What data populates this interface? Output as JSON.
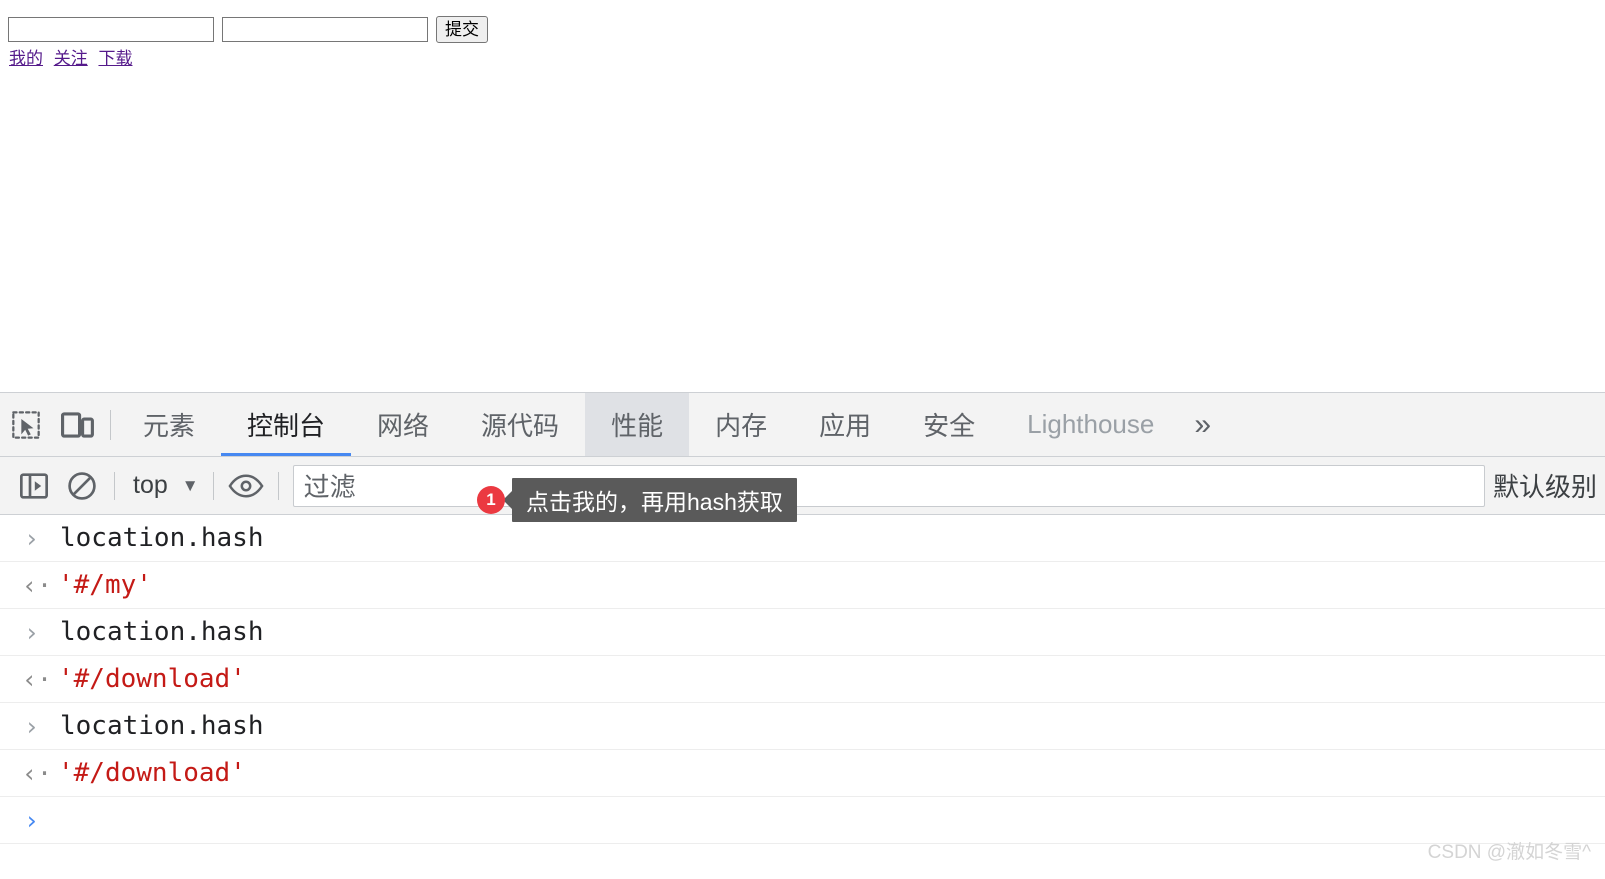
{
  "page": {
    "inputs": [
      {
        "name": "first-text-input",
        "value": "",
        "placeholder": ""
      },
      {
        "name": "second-text-input",
        "value": "",
        "placeholder": ""
      }
    ],
    "submit_label": "提交",
    "links": [
      {
        "label": "我的"
      },
      {
        "label": "关注"
      },
      {
        "label": "下载"
      }
    ],
    "link_color": "#551a8b"
  },
  "devtools": {
    "toolbar_icons": [
      {
        "name": "inspect-element-icon"
      },
      {
        "name": "device-toolbar-icon"
      }
    ],
    "tabs": [
      {
        "label": "元素",
        "state": "normal"
      },
      {
        "label": "控制台",
        "state": "active"
      },
      {
        "label": "网络",
        "state": "normal"
      },
      {
        "label": "源代码",
        "state": "normal"
      },
      {
        "label": "性能",
        "state": "hovered"
      },
      {
        "label": "内存",
        "state": "normal"
      },
      {
        "label": "应用",
        "state": "normal"
      },
      {
        "label": "安全",
        "state": "normal"
      },
      {
        "label": "Lighthouse",
        "state": "muted"
      }
    ],
    "overflow_label": "»",
    "accent_color": "#4688f1",
    "console_toolbar": {
      "sidebar_toggle": "show-console-sidebar-icon",
      "clear_console": "clear-console-icon",
      "context_value": "top",
      "context_caret": "▼",
      "live_expression": "eye-icon",
      "filter_placeholder": "过滤",
      "badge_count": "1",
      "level_label": "默认级别"
    },
    "tooltip": {
      "text": "点击我的，再用hash获取",
      "background": "#5a5a5a"
    },
    "console_entries": [
      {
        "kind": "input",
        "marker": "›",
        "text": "location.hash"
      },
      {
        "kind": "result",
        "marker": "‹·",
        "text": "'#/my'"
      },
      {
        "kind": "input",
        "marker": "›",
        "text": "location.hash"
      },
      {
        "kind": "result",
        "marker": "‹·",
        "text": "'#/download'"
      },
      {
        "kind": "input",
        "marker": "›",
        "text": "location.hash"
      },
      {
        "kind": "result",
        "marker": "‹·",
        "text": "'#/download'"
      },
      {
        "kind": "prompt",
        "marker": "›",
        "text": ""
      }
    ]
  },
  "watermark": "CSDN @澈如冬雪^"
}
